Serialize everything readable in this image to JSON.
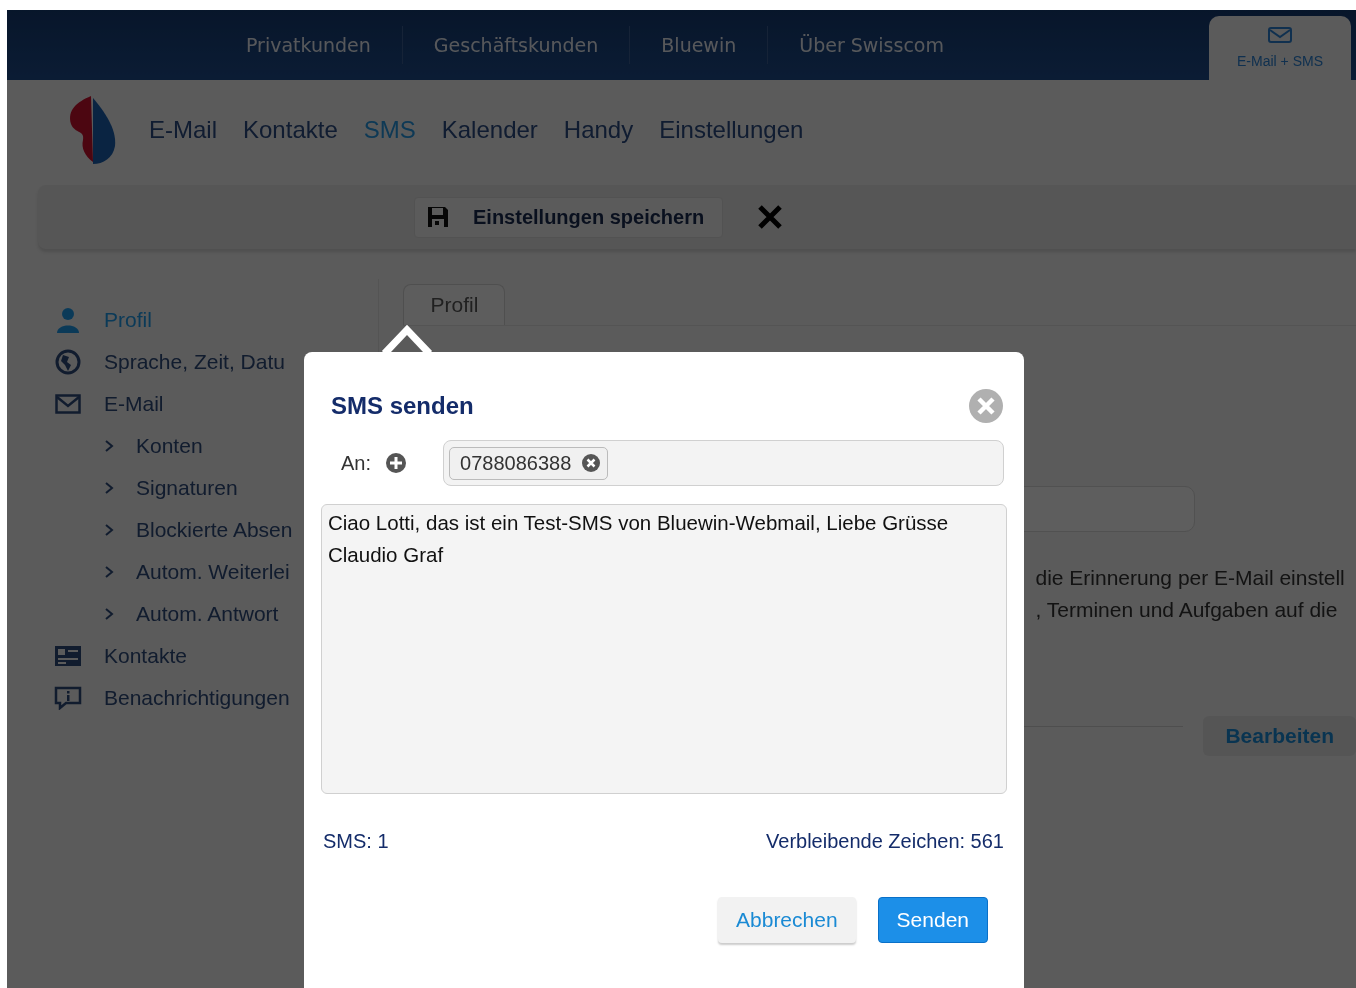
{
  "top_nav": {
    "items": [
      "Privatkunden",
      "Geschäftskunden",
      "Bluewin",
      "Über Swisscom"
    ],
    "service_tab": {
      "label": "E-Mail + SMS",
      "selected": true
    }
  },
  "main_nav": [
    {
      "label": "E-Mail",
      "selected": false
    },
    {
      "label": "Kontakte",
      "selected": false
    },
    {
      "label": "SMS",
      "selected": true
    },
    {
      "label": "Kalender",
      "selected": false
    },
    {
      "label": "Handy",
      "selected": false
    },
    {
      "label": "Einstellungen",
      "selected": false
    }
  ],
  "toolbar": {
    "save_button": "Einstellungen speichern"
  },
  "sidebar": {
    "items": [
      {
        "label": "Profil",
        "selected": true
      },
      {
        "label": "Sprache, Zeit, Datu",
        "selected": false
      },
      {
        "label": "E-Mail",
        "selected": false,
        "children": [
          {
            "label": "Konten",
            "selected": false
          },
          {
            "label": "Signaturen",
            "selected": false
          },
          {
            "label": "Blockierte Absen",
            "selected": false
          },
          {
            "label": "Autom. Weiterlei",
            "selected": false
          },
          {
            "label": "Autom. Antwort",
            "selected": false
          }
        ]
      },
      {
        "label": "Kontakte",
        "selected": false
      },
      {
        "label": "Benachrichtigungen",
        "selected": false
      }
    ]
  },
  "content": {
    "tab": "Profil",
    "lines": [
      "die Erinnerung per E-Mail einstell",
      ", Terminen und Aufgaben auf die"
    ],
    "edit_button": "Bearbeiten"
  },
  "dialog": {
    "title": "SMS senden",
    "to_label": "An:",
    "recipients": [
      "0788086388"
    ],
    "message": "Ciao Lotti, das ist ein Test-SMS von Bluewin-Webmail, Liebe Grüsse Claudio Graf",
    "sms_count": "SMS: 1",
    "remaining": "Verbleibende Zeichen: 561",
    "cancel_button": "Abbrechen",
    "send_button": "Senden"
  }
}
